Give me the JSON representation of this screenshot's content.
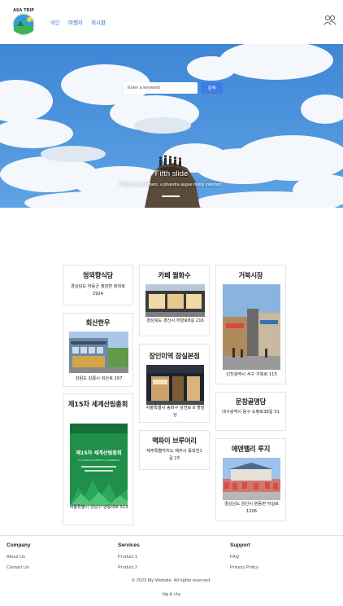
{
  "nav": {
    "logo_text": "ASA TRIP",
    "links": [
      {
        "label": "메인"
      },
      {
        "label": "여행지"
      },
      {
        "label": "게시판"
      }
    ]
  },
  "hero": {
    "search_placeholder": "Enter a keyword",
    "search_button": "검색",
    "slide_title": "Fifth slide",
    "slide_desc": "Nulla vitae elit libero, a pharetra augue mollis interdum."
  },
  "places": [
    {
      "name": "청뫼향식당",
      "address": "경상남도 하동군 청암면 청학로 2924"
    },
    {
      "name": "카페 월화수",
      "address": "경상북도 경산시 하양로8길 216"
    },
    {
      "name": "거북시장",
      "address": "인천광역시 서구 거북로 115"
    },
    {
      "name": "회산한우",
      "address": "강원도 강릉시 회산로 297"
    },
    {
      "name": "장인미역 잠실본점",
      "address": "서울특별시 송파구 삼전로 8 명빌딩"
    },
    {
      "name": "제15차 세계산림총회",
      "address": "서울특별시 강남구 영동대로 513"
    },
    {
      "name": "문창골명당",
      "address": "대구광역시 동구 도평로38길 51"
    },
    {
      "name": "맥파이 브루어리",
      "address": "제주특별자치도 제주시 동회천1길 23"
    },
    {
      "name": "에덴밸리 루지",
      "address": "경상남도 양산시 원동면 어실로 1206"
    }
  ],
  "poster": {
    "line1": "제15차 세계산림총회",
    "line2": "XV WORLD FORESTRY CONGRESS"
  },
  "footer": {
    "company": {
      "heading": "Company",
      "links": [
        "About Us",
        "Contact Us"
      ]
    },
    "services": {
      "heading": "Services",
      "links": [
        "Product 1",
        "Product 2"
      ]
    },
    "support": {
      "heading": "Support",
      "links": [
        "FAQ",
        "Privacy Policy"
      ]
    },
    "copyright": "© 2023 My Website. All rights reserved.",
    "authors": "ldg & chy"
  },
  "colors": {
    "accent": "#3d7be8",
    "nav_link": "#2b6cc4",
    "sky": "#4a90d9"
  }
}
